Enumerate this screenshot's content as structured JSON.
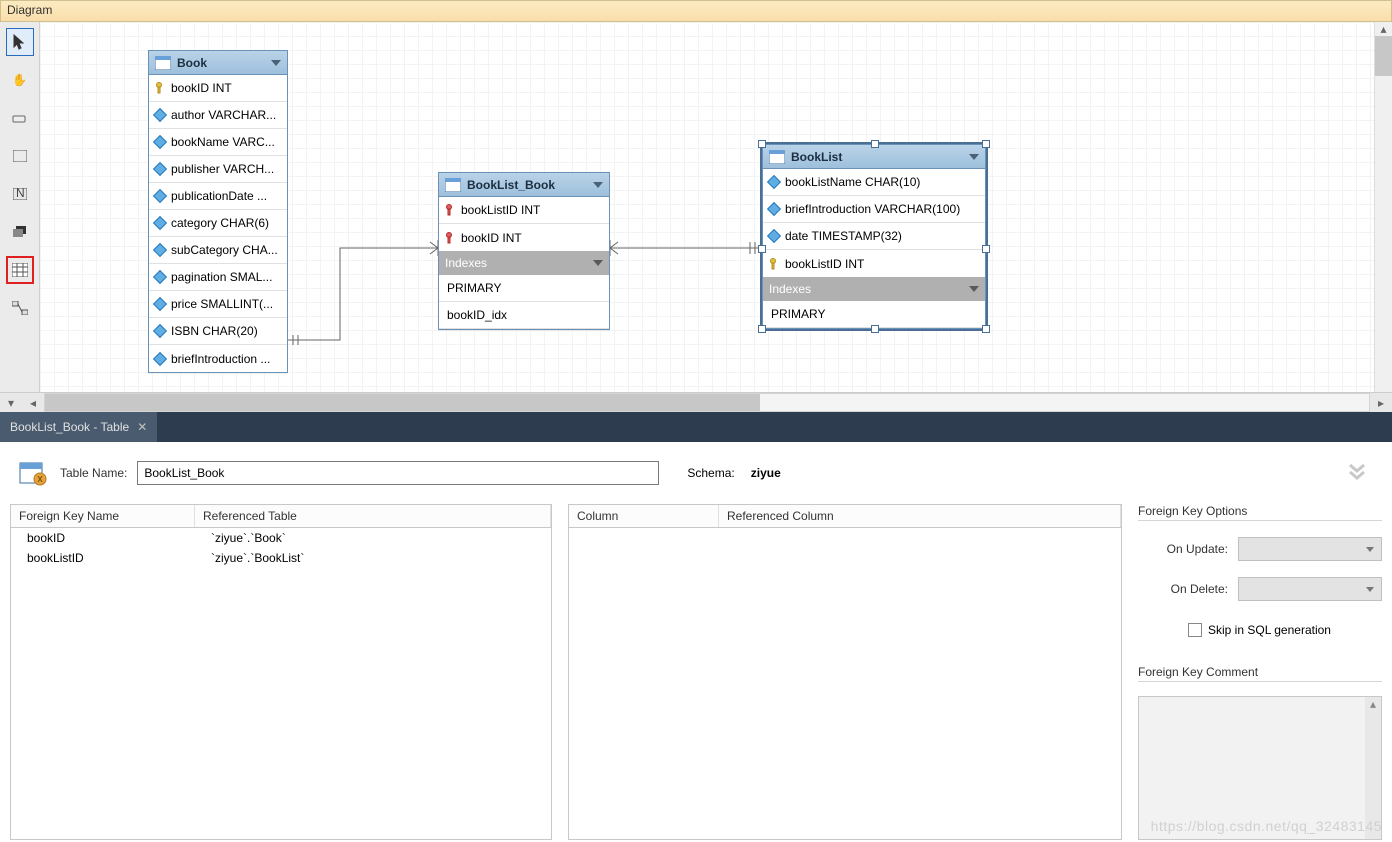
{
  "title": "Diagram",
  "toolbar": [
    {
      "name": "pointer",
      "glyph": "pointer",
      "selected": true
    },
    {
      "name": "hand",
      "glyph": "hand"
    },
    {
      "name": "eraser",
      "glyph": "eraser"
    },
    {
      "name": "note",
      "glyph": "note"
    },
    {
      "name": "image",
      "glyph": "image"
    },
    {
      "name": "layer",
      "glyph": "layer"
    },
    {
      "name": "table",
      "glyph": "grid",
      "redbox": true
    },
    {
      "name": "relation",
      "glyph": "rel"
    }
  ],
  "entities": {
    "book": {
      "title": "Book",
      "columns": [
        {
          "icon": "key",
          "text": "bookID INT"
        },
        {
          "icon": "diamond",
          "text": "author VARCHAR..."
        },
        {
          "icon": "diamond",
          "text": "bookName VARC..."
        },
        {
          "icon": "diamond",
          "text": "publisher VARCH..."
        },
        {
          "icon": "diamond",
          "text": "publicationDate ..."
        },
        {
          "icon": "diamond",
          "text": "category CHAR(6)"
        },
        {
          "icon": "diamond",
          "text": "subCategory CHA..."
        },
        {
          "icon": "diamond",
          "text": "pagination SMAL..."
        },
        {
          "icon": "diamond",
          "text": "price SMALLINT(..."
        },
        {
          "icon": "diamond",
          "text": "ISBN CHAR(20)"
        },
        {
          "icon": "diamond",
          "text": "briefIntroduction ..."
        }
      ]
    },
    "booklist_book": {
      "title": "BookList_Book",
      "columns": [
        {
          "icon": "redkey",
          "text": "bookListID INT"
        },
        {
          "icon": "redkey",
          "text": "bookID INT"
        }
      ],
      "indexes_label": "Indexes",
      "indexes": [
        "PRIMARY",
        "bookID_idx"
      ]
    },
    "booklist": {
      "title": "BookList",
      "selected": true,
      "columns": [
        {
          "icon": "diamond",
          "text": "bookListName CHAR(10)"
        },
        {
          "icon": "diamond",
          "text": "briefIntroduction VARCHAR(100)"
        },
        {
          "icon": "diamond",
          "text": "date TIMESTAMP(32)"
        },
        {
          "icon": "key",
          "text": "bookListID INT"
        }
      ],
      "indexes_label": "Indexes",
      "indexes": [
        "PRIMARY"
      ]
    }
  },
  "bottom_tab": {
    "label": "BookList_Book - Table"
  },
  "editor": {
    "table_name_label": "Table Name:",
    "table_name_value": "BookList_Book",
    "schema_label": "Schema:",
    "schema_value": "ziyue",
    "fk_grid": {
      "headers": [
        "Foreign Key Name",
        "Referenced Table"
      ],
      "rows": [
        {
          "name": "bookID",
          "ref": "`ziyue`.`Book`"
        },
        {
          "name": "bookListID",
          "ref": "`ziyue`.`BookList`"
        }
      ]
    },
    "col_grid": {
      "headers": [
        "Column",
        "Referenced Column"
      ]
    },
    "fk_options": {
      "title": "Foreign Key Options",
      "on_update": "On Update:",
      "on_delete": "On Delete:",
      "skip": "Skip in SQL generation"
    },
    "fk_comment": {
      "title": "Foreign Key Comment"
    }
  },
  "watermark": "https://blog.csdn.net/qq_32483145"
}
